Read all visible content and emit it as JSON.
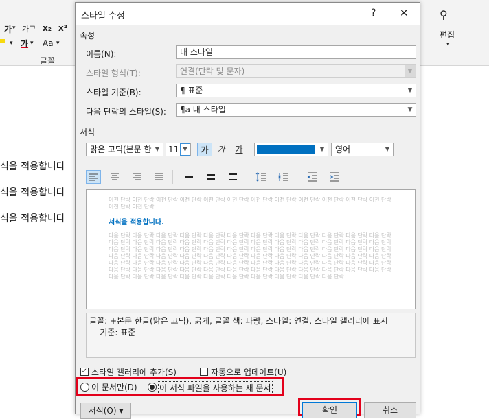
{
  "background": {
    "ribbon": {
      "font_row1": [
        "가",
        "가⁠",
        "x₂",
        "x²"
      ],
      "font_row2": [
        "가",
        "Aa"
      ],
      "group_label": "글꼴",
      "edit_label": "편집"
    },
    "doc_lines": [
      "식을 적용합니다",
      "식을 적용합니다",
      "식을 적용합니다"
    ]
  },
  "dialog": {
    "title": "스타일 수정",
    "help": "?",
    "close": "✕",
    "section_properties": "속성",
    "name_label": "이름(N):",
    "name_value": "내 스타일",
    "type_label": "스타일 형식(T):",
    "type_value": "연결(단락 및 문자)",
    "based_label": "스타일 기준(B):",
    "based_value": "¶ 표준",
    "next_label": "다음 단락의 스타일(S):",
    "next_value": "¶a 내 스타일",
    "section_format": "서식",
    "font_name": "맑은 고딕(본문 한",
    "font_size": "11",
    "bold": "가",
    "italic": "가",
    "underline": "가",
    "color_hex": "#0070c0",
    "language": "영어",
    "preview": {
      "prev_para": "이전 단락 이전 단락 이전 단락 이전 단락 이전 단락 이전 단락 이전 단락 이전 단락 이전 단락 이전 단락 이전 단락 이전 단락 이전 단락 이전 단락",
      "sample": "서식을 적용합니다.",
      "next_para": "다음 단락 다음 단락 다음 단락 다음 단락 다음 단락 다음 단락 다음 단락 다음 단락 다음 단락 다음 단락 다음 단락 다음 단락 다음 단락 다음 단락 다음 단락 다음 단락 다음 단락 다음 단락 다음 단락 다음 단락 다음 단락 다음 단락 다음 단락 다음 단락 다음 단락 다음 단락 다음 단락 다음 단락 다음 단락 다음 단락 다음 단락 다음 단락 다음 단락 다음 단락 다음 단락 다음 단락 다음 단락 다음 단락 다음 단락 다음 단락 다음 단락 다음 단락 다음 단락 다음 단락 다음 단락 다음 단락 다음 단락 다음 단락 다음 단락 다음 단락 다음 단락 다음 단락 다음 단락 다음 단락 다음 단락 다음 단락 다음 단락 다음 단락 다음 단락 다음 단락 다음 단락 다음 단락 다음 단락 다음 단락 다음 단락 다음 단락 다음 단락 다음 단락 다음 단락 다음 단락 다음 단락 다음 단락 다음 단락 다음 단락 다음 단락 다음 단락 다음 단락 다음 단락 다음 단락 다음 단락 다음 단락 다음 단락"
    },
    "description": "글꼴: +본문 한글(맑은 고딕), 굵게, 글꼴 색: 파랑, 스타일: 연결, 스타일 갤러리에 표시\n    기준: 표준",
    "add_gallery": "스타일 갤러리에 추가(S)",
    "auto_update": "자동으로 업데이트(U)",
    "only_doc": "이 문서만(D)",
    "new_docs": "이 서식 파일을 사용하는 새 문서",
    "format_btn": "서식(O) ▾",
    "ok": "확인",
    "cancel": "취소"
  }
}
